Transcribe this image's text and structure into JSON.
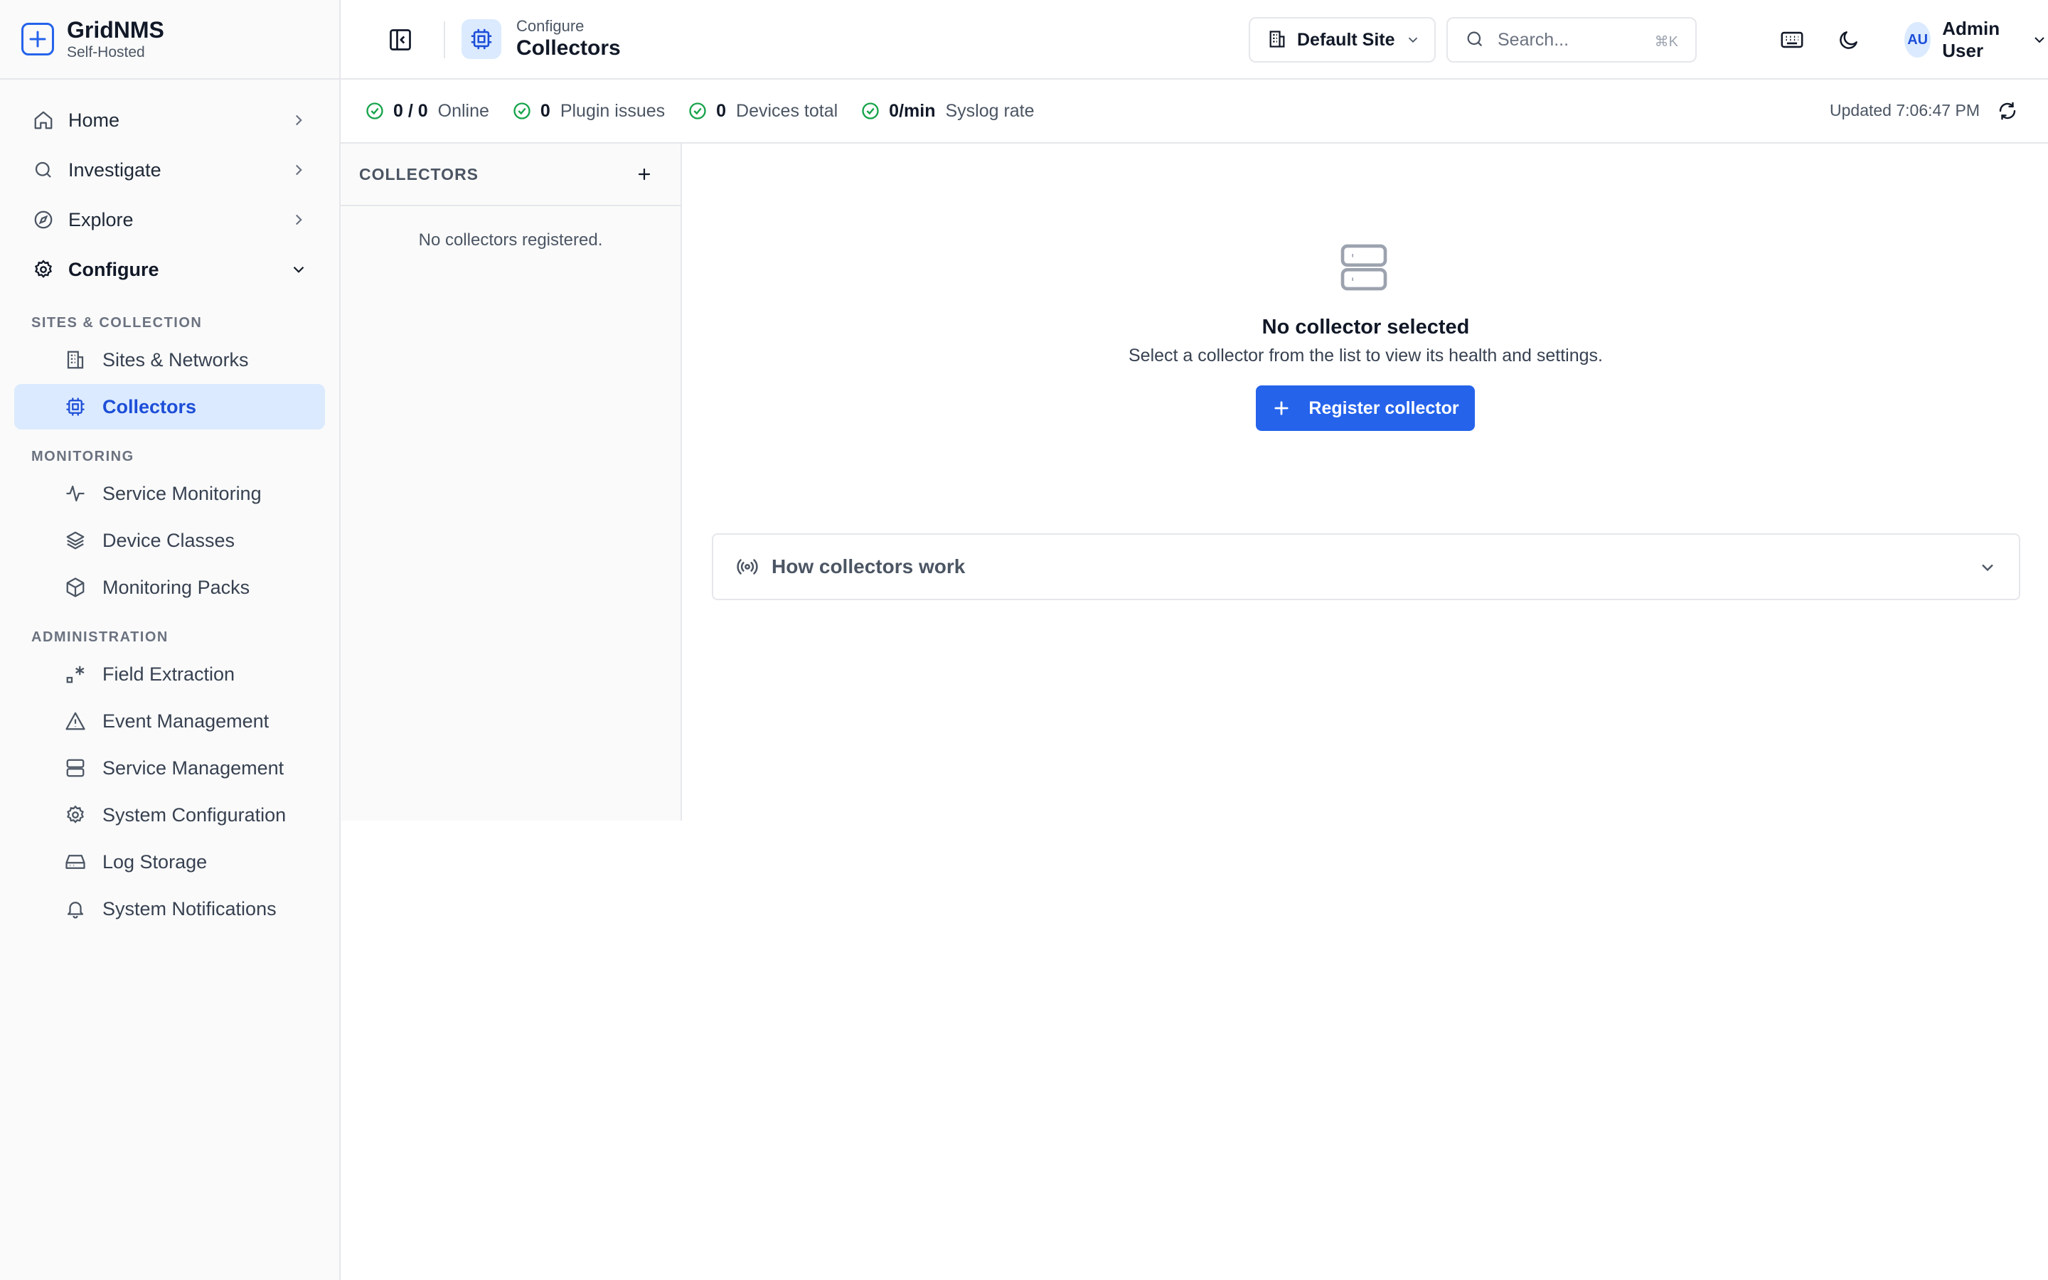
{
  "brand": {
    "name": "GridNMS",
    "subtitle": "Self-Hosted"
  },
  "sidebar": {
    "top_items": [
      {
        "label": "Home",
        "icon": "home-icon",
        "expanded": false
      },
      {
        "label": "Investigate",
        "icon": "search-icon",
        "expanded": false
      },
      {
        "label": "Explore",
        "icon": "compass-icon",
        "expanded": false
      },
      {
        "label": "Configure",
        "icon": "gear-icon",
        "expanded": true
      }
    ],
    "sections": [
      {
        "label": "SITES & COLLECTION",
        "items": [
          {
            "label": "Sites & Networks",
            "icon": "building-icon"
          },
          {
            "label": "Collectors",
            "icon": "chip-icon",
            "active": true
          }
        ]
      },
      {
        "label": "MONITORING",
        "items": [
          {
            "label": "Service Monitoring",
            "icon": "activity-icon"
          },
          {
            "label": "Device Classes",
            "icon": "layers-icon"
          },
          {
            "label": "Monitoring Packs",
            "icon": "package-icon"
          }
        ]
      },
      {
        "label": "ADMINISTRATION",
        "items": [
          {
            "label": "Field Extraction",
            "icon": "regex-icon"
          },
          {
            "label": "Event Management",
            "icon": "warning-icon"
          },
          {
            "label": "Service Management",
            "icon": "server-icon"
          },
          {
            "label": "System Configuration",
            "icon": "gear-icon"
          },
          {
            "label": "Log Storage",
            "icon": "hard-drive-icon"
          },
          {
            "label": "System Notifications",
            "icon": "bell-icon"
          }
        ]
      }
    ]
  },
  "header": {
    "breadcrumb_parent": "Configure",
    "title": "Collectors",
    "site": "Default Site",
    "search_placeholder": "Search...",
    "search_shortcut": "⌘K",
    "user_initials": "AU",
    "user_name": "Admin User"
  },
  "status": {
    "items": [
      {
        "value": "0 / 0",
        "label": "Online"
      },
      {
        "value": "0",
        "label": "Plugin issues"
      },
      {
        "value": "0",
        "label": "Devices total"
      },
      {
        "value": "0/min",
        "label": "Syslog rate"
      }
    ],
    "updated": "Updated 7:06:47 PM"
  },
  "collectors_panel": {
    "heading": "COLLECTORS",
    "empty_text": "No collectors registered."
  },
  "main": {
    "empty_title": "No collector selected",
    "empty_subtitle": "Select a collector from the list to view its health and settings.",
    "register_label": "Register collector",
    "accordion_label": "How collectors work"
  },
  "colors": {
    "accent": "#2563eb",
    "active_bg": "#dbeafe",
    "ok": "#16a34a"
  }
}
